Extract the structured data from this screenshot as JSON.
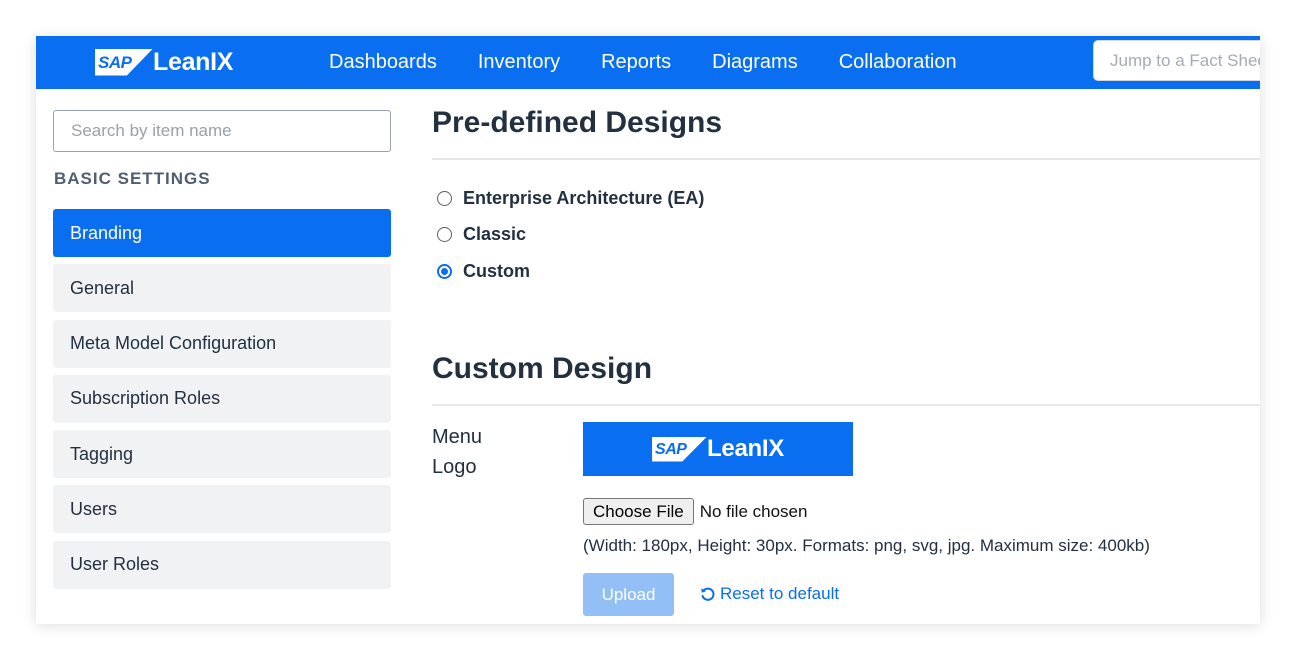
{
  "header": {
    "brand": {
      "mark": "SAP",
      "name": "LeanIX"
    },
    "nav": [
      "Dashboards",
      "Inventory",
      "Reports",
      "Diagrams",
      "Collaboration"
    ],
    "jump_placeholder": "Jump to a Fact Sheet"
  },
  "sidebar": {
    "search_placeholder": "Search by item name",
    "section_title": "BASIC SETTINGS",
    "items": [
      {
        "label": "Branding",
        "active": true
      },
      {
        "label": "General"
      },
      {
        "label": "Meta Model Configuration"
      },
      {
        "label": "Subscription Roles"
      },
      {
        "label": "Tagging"
      },
      {
        "label": "Users"
      },
      {
        "label": "User Roles"
      }
    ]
  },
  "main": {
    "predefined_title": "Pre-defined Designs",
    "designs": [
      {
        "label": "Enterprise Architecture (EA)",
        "checked": false
      },
      {
        "label": "Classic",
        "checked": false
      },
      {
        "label": "Custom",
        "checked": true
      }
    ],
    "custom_title": "Custom Design",
    "menu_logo_label": "Menu Logo",
    "preview_logo": {
      "mark": "SAP",
      "name": "LeanIX"
    },
    "choose_file_label": "Choose File",
    "file_status": "No file chosen",
    "hint": "(Width: 180px, Height: 30px. Formats: png, svg, jpg. Maximum size: 400kb)",
    "upload_label": "Upload",
    "reset_label": "Reset to default"
  },
  "colors": {
    "accent": "#0a6ef0",
    "upload_disabled": "#93bff7",
    "menu_bg": "#f1f2f4",
    "text": "#223040"
  }
}
